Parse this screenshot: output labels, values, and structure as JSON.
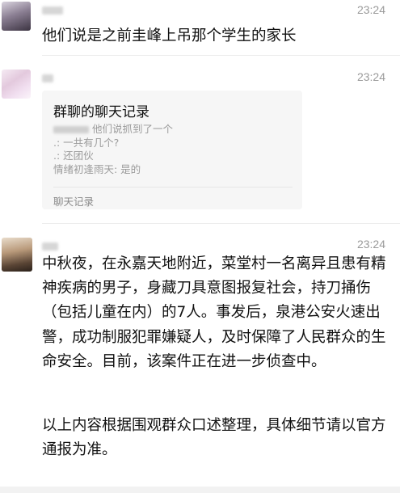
{
  "messages": [
    {
      "time": "23:24",
      "text": "他们说是之前圭峰上吊那个学生的家长"
    },
    {
      "time": "23:24",
      "record": {
        "title": "群聊的聊天记录",
        "lines": [
          "他们说抓到了一个",
          ".: 一共有几个?",
          ".: 还团伙",
          "情绪初逢雨天: 是的"
        ],
        "footer": "聊天记录"
      }
    },
    {
      "time": "23:24",
      "paragraphs": [
        "中秋夜，在永嘉天地附近，菜堂村一名离异且患有精神疾病的男子，身藏刀具意图报复社会，持刀捅伤（包括儿童在内）的7人。事发后，泉港公安火速出警，成功制服犯罪嫌疑人，及时保障了人民群众的生命安全。目前，该案件正在进一步侦查中。",
        "以上内容根据围观群众口述整理，具体细节请以官方通报为准。"
      ]
    }
  ]
}
